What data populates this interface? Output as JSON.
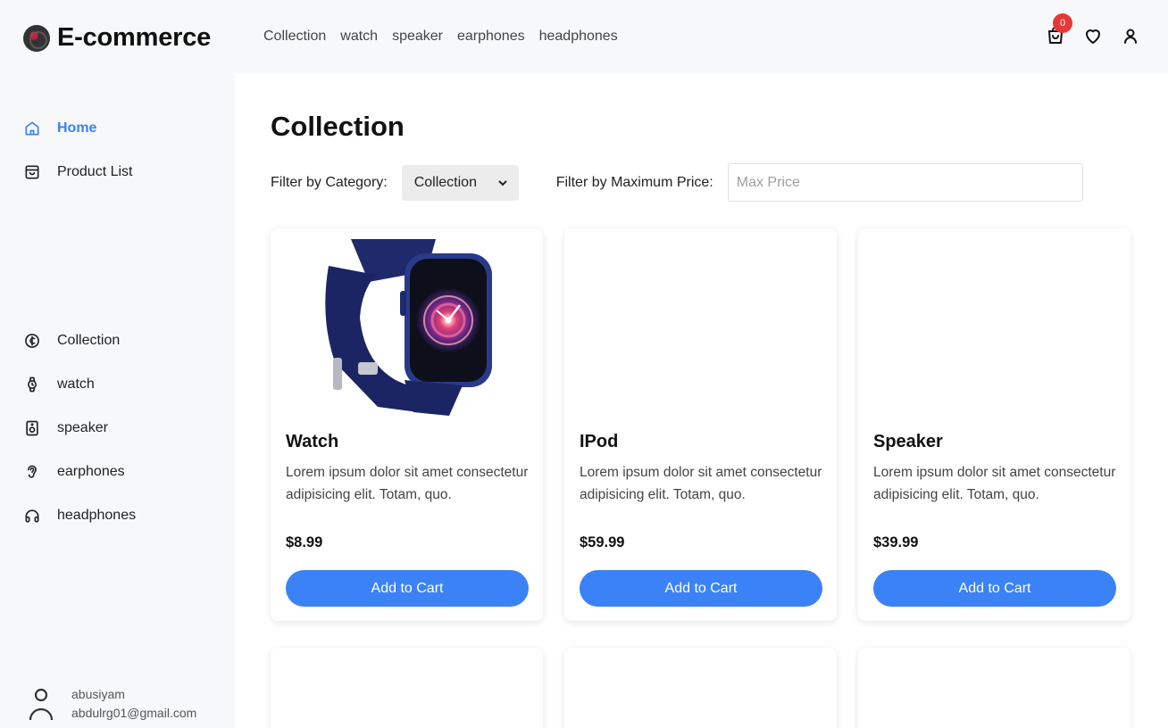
{
  "brand": {
    "title": "E-commerce"
  },
  "topnav": [
    "Collection",
    "watch",
    "speaker",
    "earphones",
    "headphones"
  ],
  "header": {
    "cart_count": "0"
  },
  "sidebar": {
    "main_items": [
      {
        "label": "Home",
        "icon": "home-icon",
        "active": true
      },
      {
        "label": "Product List",
        "icon": "shopping-bag-icon",
        "active": false
      }
    ],
    "category_items": [
      {
        "label": "Collection",
        "icon": "cedi-coin-icon"
      },
      {
        "label": "watch",
        "icon": "watch-icon"
      },
      {
        "label": "speaker",
        "icon": "speaker-icon"
      },
      {
        "label": "earphones",
        "icon": "ear-icon"
      },
      {
        "label": "headphones",
        "icon": "headphones-icon"
      }
    ],
    "user": {
      "name": "abusiyam",
      "email": "abdulrg01@gmail.com"
    }
  },
  "main": {
    "title": "Collection",
    "filters": {
      "category_label": "Filter by Category:",
      "category_value": "Collection",
      "price_label": "Filter by Maximum Price:",
      "price_placeholder": "Max Price"
    },
    "products": [
      {
        "name": "Watch",
        "description": "Lorem ipsum dolor sit amet consectetur adipisicing elit. Totam, quo.",
        "price": "$8.99",
        "button": "Add to Cart"
      },
      {
        "name": "IPod",
        "description": "Lorem ipsum dolor sit amet consectetur adipisicing elit. Totam, quo.",
        "price": "$59.99",
        "button": "Add to Cart"
      },
      {
        "name": "Speaker",
        "description": "Lorem ipsum dolor sit amet consectetur adipisicing elit. Totam, quo.",
        "price": "$39.99",
        "button": "Add to Cart"
      }
    ]
  },
  "colors": {
    "accent": "#3b82f6",
    "badge": "#e53935"
  }
}
